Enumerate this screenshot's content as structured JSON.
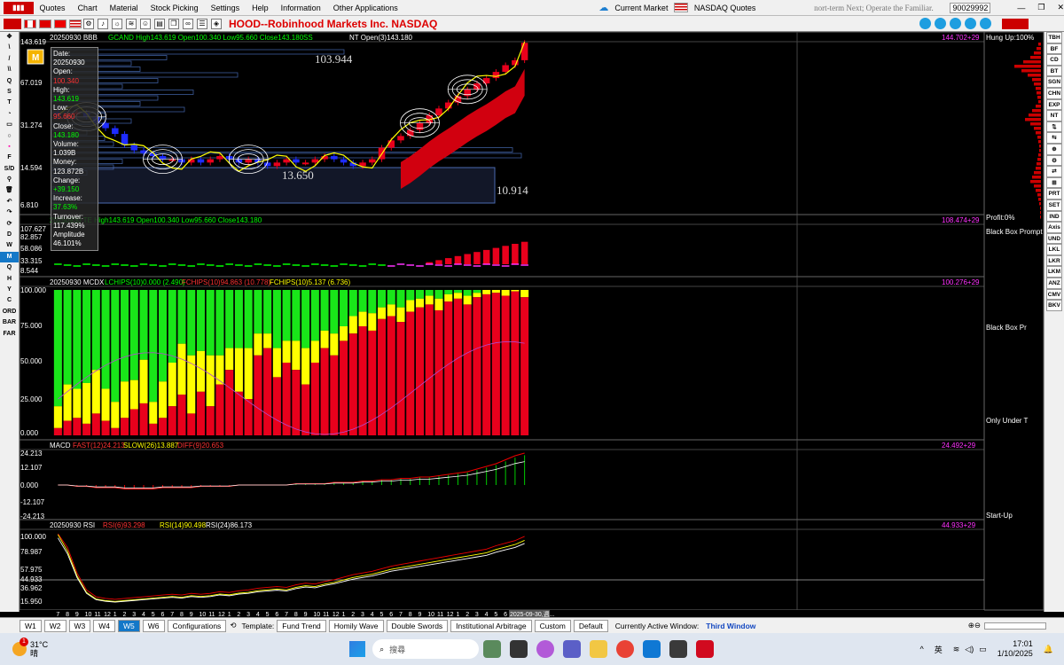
{
  "menubar": {
    "items": [
      "Quotes",
      "Chart",
      "Material",
      "Stock Picking",
      "Settings",
      "Help",
      "Information",
      "Other Applications"
    ],
    "market_label": "Current Market",
    "market_value": "NASDAQ Quotes",
    "marquee": "nort-term Next; Operate the Familiar.",
    "account": "90029992"
  },
  "toolbar": {
    "title": "HOOD--Robinhood Markets Inc.  NASDAQ"
  },
  "colors": {
    "up": "#e8001c",
    "down": "#1e2cff",
    "accent_yellow": "#ffff00",
    "label_green": "#00ff33",
    "magenta": "#ff33ff"
  },
  "panel1": {
    "header": "20250930 BBB",
    "candle_info": "GCAND High143.619 Open100.340 Low95.660 Close143.180",
    "ss": "SS",
    "nt": "NT Open(3)143.180",
    "right_val": "144.702+29",
    "hung": "Hung Up:100%",
    "price_labels": [
      "143.619",
      "67.019",
      "31.274",
      "14.594",
      "6.810"
    ],
    "level_a": "103.944",
    "level_b": "13.650",
    "level_c": "10.914"
  },
  "panel2": {
    "header": "20250930 TE High143.619 Open100.340 Low95.660 Close143.180",
    "right_val": "108.474+29",
    "labels": [
      "107.627",
      "82.857",
      "58.086",
      "33.315",
      "8.544"
    ]
  },
  "panel3": {
    "header": "20250930 MCDX",
    "lc": "LCHIPS(10)0.000 (2.490)",
    "fc": "FCHIPS(10)94.863 (10.778)",
    "fc2": "FCHIPS(10)5.137 (6.736)",
    "right_val": "100.276+29",
    "labels": [
      "100.000",
      "75.000",
      "50.000",
      "25.000",
      "0.000"
    ]
  },
  "panel4": {
    "header": "MACD",
    "fast": "FAST(12)24.213",
    "slow": "SLOW(26)13.887",
    "diff": "DIFF(9)20.653",
    "right_val": "24.492+29",
    "labels": [
      "24.213",
      "12.107",
      "0.000",
      "-12.107",
      "-24.213"
    ]
  },
  "panel5": {
    "header": "20250930 RSI",
    "r1": "RSI(6)93.298",
    "r2": "RSI(14)90.498",
    "r3": "RSI(24)86.173",
    "right_val": "44.933+29",
    "labels": [
      "100.000",
      "78.987",
      "57.975",
      "44.933",
      "36.962",
      "15.950"
    ]
  },
  "xaxis": {
    "ticks": [
      "7",
      "8",
      "9",
      "10",
      "11",
      "12",
      "1",
      "2",
      "3",
      "4",
      "5",
      "6",
      "7",
      "8",
      "9",
      "10",
      "11",
      "12",
      "1",
      "2",
      "3",
      "4",
      "5",
      "6",
      "7",
      "8",
      "9",
      "10",
      "11",
      "12",
      "1",
      "2",
      "3",
      "4",
      "5",
      "6",
      "7",
      "8",
      "9",
      "10",
      "11",
      "12",
      "1",
      "2",
      "3",
      "4",
      "5",
      "6",
      "7"
    ],
    "last": "2025-09-30,週..."
  },
  "side_labels": {
    "profit": "Profit:0%",
    "bbp": "Black Box Prompt",
    "bbp2": "Black Box Pr",
    "under": "Only Under T",
    "startup": "Start-Up"
  },
  "infobox": {
    "rows": [
      [
        "Date:",
        "20250930"
      ],
      [
        "Open:",
        "100.340"
      ],
      [
        "High:",
        "143.619"
      ],
      [
        "Low:",
        "95.660"
      ],
      [
        "Close:",
        "143.180"
      ],
      [
        "Volume:",
        "1.039B"
      ],
      [
        "Money:",
        "123.872B"
      ],
      [
        "Change:",
        "+39.150"
      ],
      [
        "Increase:",
        "37.63%"
      ],
      [
        "Turnover:",
        "117.439%"
      ],
      [
        "Amplitude",
        "46.101%"
      ]
    ]
  },
  "leftbar": {
    "items": [
      "✥",
      "\\",
      "/",
      "\\\\",
      "Q",
      "S",
      "T",
      "◔",
      "▭",
      "○",
      "▪",
      "F",
      "S/D",
      "⚲",
      "🗑",
      "↶",
      "↷",
      "⟳",
      "D",
      "W",
      "M",
      "Q",
      "H",
      "Y",
      "C",
      "ORD",
      "BAR",
      "FAR"
    ]
  },
  "rightbar": {
    "items": [
      "TBH",
      "BF",
      "CD",
      "BT",
      "SGN",
      "CHN",
      "EXP",
      "NT",
      "⇅",
      "⇆",
      "⊕",
      "⚙",
      "⇄",
      "⊞",
      "PRT",
      "SET",
      "IND",
      "Axis",
      "UND",
      "LKL",
      "LKR",
      "LKM",
      "ANZ",
      "CMV",
      "BKV"
    ]
  },
  "bottombar": {
    "tabs": [
      "W1",
      "W2",
      "W3",
      "W4",
      "W5",
      "W6",
      "Configurations"
    ],
    "template_label": "Template:",
    "templates": [
      "Fund Trend",
      "Homily Wave",
      "Double Swords",
      "Institutional Arbitrage",
      "Custom",
      "Default"
    ],
    "active_label": "Currently Active Window:",
    "active_value": "Third Window"
  },
  "taskbar": {
    "weather": "31°C",
    "weather_sub": "晴",
    "search": "搜尋",
    "lang": "英",
    "time": "17:01",
    "date": "1/10/2025",
    "badge": "1"
  },
  "chart_data": {
    "type": "bar",
    "title": "HOOD--Robinhood Markets Inc.  NASDAQ",
    "xlabel": "",
    "ylabel": "",
    "price_close": [
      38,
      39,
      40,
      37,
      33,
      30,
      27,
      22,
      20,
      19,
      18,
      17,
      17,
      16,
      17,
      16,
      17,
      18,
      17,
      16,
      17,
      16,
      15,
      16,
      17,
      16,
      16,
      17,
      18,
      17,
      16,
      15,
      16,
      17,
      21,
      24,
      26,
      29,
      33,
      38,
      43,
      48,
      54,
      61,
      68,
      75,
      84,
      95,
      104,
      143
    ],
    "mcdx_red": [
      5,
      10,
      12,
      8,
      15,
      10,
      5,
      12,
      18,
      22,
      8,
      12,
      20,
      28,
      15,
      30,
      20,
      35,
      45,
      30,
      25,
      55,
      60,
      40,
      50,
      45,
      35,
      50,
      60,
      55,
      65,
      70,
      75,
      72,
      80,
      82,
      78,
      85,
      88,
      90,
      86,
      92,
      94,
      90,
      95,
      97,
      98,
      96,
      99,
      95
    ],
    "mcdx_yellow": [
      15,
      25,
      20,
      28,
      30,
      22,
      18,
      25,
      20,
      30,
      15,
      25,
      30,
      35,
      40,
      28,
      35,
      20,
      15,
      30,
      35,
      15,
      10,
      20,
      15,
      20,
      25,
      15,
      12,
      15,
      10,
      12,
      10,
      12,
      8,
      8,
      10,
      8,
      6,
      6,
      8,
      5,
      4,
      6,
      3,
      3,
      2,
      4,
      1,
      5
    ],
    "macd": [
      0,
      0,
      -1,
      -1,
      -2,
      -2,
      -2,
      -3,
      -3,
      -3,
      -3,
      -2,
      -2,
      -2,
      -2,
      -1,
      -1,
      -1,
      -1,
      0,
      0,
      0,
      0,
      0,
      0,
      1,
      1,
      1,
      1,
      2,
      2,
      2,
      3,
      3,
      4,
      4,
      5,
      5,
      6,
      6,
      7,
      8,
      9,
      10,
      12,
      14,
      16,
      19,
      22,
      24
    ],
    "rsi": [
      100,
      80,
      50,
      30,
      22,
      20,
      19,
      20,
      21,
      22,
      23,
      24,
      25,
      24,
      26,
      25,
      26,
      28,
      27,
      29,
      30,
      32,
      33,
      34,
      33,
      36,
      38,
      37,
      40,
      42,
      45,
      48,
      50,
      52,
      55,
      58,
      60,
      62,
      64,
      66,
      68,
      70,
      72,
      74,
      76,
      78,
      82,
      85,
      88,
      93
    ]
  }
}
